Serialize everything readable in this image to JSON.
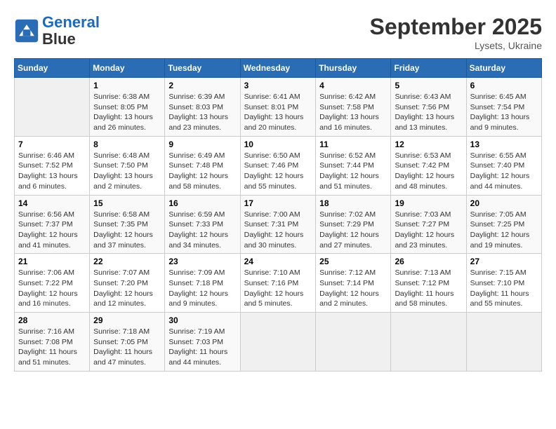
{
  "header": {
    "logo_line1": "General",
    "logo_line2": "Blue",
    "month": "September 2025",
    "location": "Lysets, Ukraine"
  },
  "days_of_week": [
    "Sunday",
    "Monday",
    "Tuesday",
    "Wednesday",
    "Thursday",
    "Friday",
    "Saturday"
  ],
  "weeks": [
    [
      {
        "day": "",
        "info": ""
      },
      {
        "day": "1",
        "info": "Sunrise: 6:38 AM\nSunset: 8:05 PM\nDaylight: 13 hours\nand 26 minutes."
      },
      {
        "day": "2",
        "info": "Sunrise: 6:39 AM\nSunset: 8:03 PM\nDaylight: 13 hours\nand 23 minutes."
      },
      {
        "day": "3",
        "info": "Sunrise: 6:41 AM\nSunset: 8:01 PM\nDaylight: 13 hours\nand 20 minutes."
      },
      {
        "day": "4",
        "info": "Sunrise: 6:42 AM\nSunset: 7:58 PM\nDaylight: 13 hours\nand 16 minutes."
      },
      {
        "day": "5",
        "info": "Sunrise: 6:43 AM\nSunset: 7:56 PM\nDaylight: 13 hours\nand 13 minutes."
      },
      {
        "day": "6",
        "info": "Sunrise: 6:45 AM\nSunset: 7:54 PM\nDaylight: 13 hours\nand 9 minutes."
      }
    ],
    [
      {
        "day": "7",
        "info": "Sunrise: 6:46 AM\nSunset: 7:52 PM\nDaylight: 13 hours\nand 6 minutes."
      },
      {
        "day": "8",
        "info": "Sunrise: 6:48 AM\nSunset: 7:50 PM\nDaylight: 13 hours\nand 2 minutes."
      },
      {
        "day": "9",
        "info": "Sunrise: 6:49 AM\nSunset: 7:48 PM\nDaylight: 12 hours\nand 58 minutes."
      },
      {
        "day": "10",
        "info": "Sunrise: 6:50 AM\nSunset: 7:46 PM\nDaylight: 12 hours\nand 55 minutes."
      },
      {
        "day": "11",
        "info": "Sunrise: 6:52 AM\nSunset: 7:44 PM\nDaylight: 12 hours\nand 51 minutes."
      },
      {
        "day": "12",
        "info": "Sunrise: 6:53 AM\nSunset: 7:42 PM\nDaylight: 12 hours\nand 48 minutes."
      },
      {
        "day": "13",
        "info": "Sunrise: 6:55 AM\nSunset: 7:40 PM\nDaylight: 12 hours\nand 44 minutes."
      }
    ],
    [
      {
        "day": "14",
        "info": "Sunrise: 6:56 AM\nSunset: 7:37 PM\nDaylight: 12 hours\nand 41 minutes."
      },
      {
        "day": "15",
        "info": "Sunrise: 6:58 AM\nSunset: 7:35 PM\nDaylight: 12 hours\nand 37 minutes."
      },
      {
        "day": "16",
        "info": "Sunrise: 6:59 AM\nSunset: 7:33 PM\nDaylight: 12 hours\nand 34 minutes."
      },
      {
        "day": "17",
        "info": "Sunrise: 7:00 AM\nSunset: 7:31 PM\nDaylight: 12 hours\nand 30 minutes."
      },
      {
        "day": "18",
        "info": "Sunrise: 7:02 AM\nSunset: 7:29 PM\nDaylight: 12 hours\nand 27 minutes."
      },
      {
        "day": "19",
        "info": "Sunrise: 7:03 AM\nSunset: 7:27 PM\nDaylight: 12 hours\nand 23 minutes."
      },
      {
        "day": "20",
        "info": "Sunrise: 7:05 AM\nSunset: 7:25 PM\nDaylight: 12 hours\nand 19 minutes."
      }
    ],
    [
      {
        "day": "21",
        "info": "Sunrise: 7:06 AM\nSunset: 7:22 PM\nDaylight: 12 hours\nand 16 minutes."
      },
      {
        "day": "22",
        "info": "Sunrise: 7:07 AM\nSunset: 7:20 PM\nDaylight: 12 hours\nand 12 minutes."
      },
      {
        "day": "23",
        "info": "Sunrise: 7:09 AM\nSunset: 7:18 PM\nDaylight: 12 hours\nand 9 minutes."
      },
      {
        "day": "24",
        "info": "Sunrise: 7:10 AM\nSunset: 7:16 PM\nDaylight: 12 hours\nand 5 minutes."
      },
      {
        "day": "25",
        "info": "Sunrise: 7:12 AM\nSunset: 7:14 PM\nDaylight: 12 hours\nand 2 minutes."
      },
      {
        "day": "26",
        "info": "Sunrise: 7:13 AM\nSunset: 7:12 PM\nDaylight: 11 hours\nand 58 minutes."
      },
      {
        "day": "27",
        "info": "Sunrise: 7:15 AM\nSunset: 7:10 PM\nDaylight: 11 hours\nand 55 minutes."
      }
    ],
    [
      {
        "day": "28",
        "info": "Sunrise: 7:16 AM\nSunset: 7:08 PM\nDaylight: 11 hours\nand 51 minutes."
      },
      {
        "day": "29",
        "info": "Sunrise: 7:18 AM\nSunset: 7:05 PM\nDaylight: 11 hours\nand 47 minutes."
      },
      {
        "day": "30",
        "info": "Sunrise: 7:19 AM\nSunset: 7:03 PM\nDaylight: 11 hours\nand 44 minutes."
      },
      {
        "day": "",
        "info": ""
      },
      {
        "day": "",
        "info": ""
      },
      {
        "day": "",
        "info": ""
      },
      {
        "day": "",
        "info": ""
      }
    ]
  ]
}
